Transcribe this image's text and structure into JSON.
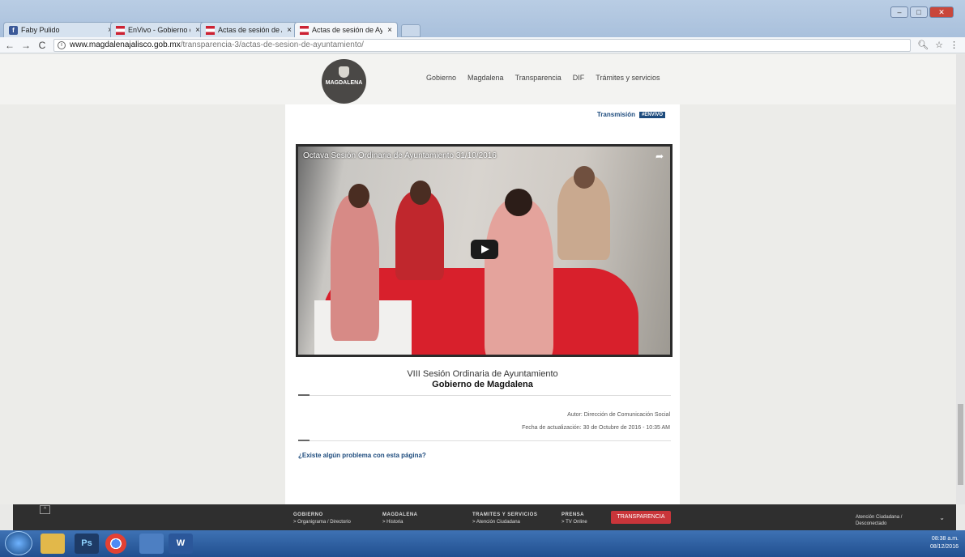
{
  "browser": {
    "tabs": [
      {
        "label": "Faby Pulido",
        "icon": "facebook-icon"
      },
      {
        "label": "EnVivo - Gobierno de M",
        "icon": "gobierno-icon"
      },
      {
        "label": "Actas de sesión de Ayun",
        "icon": "gobierno-icon"
      },
      {
        "label": "Actas de sesión de Ayun",
        "icon": "gobierno-icon",
        "active": true
      }
    ],
    "tab_close": "×",
    "url_host": "www.magdalenajalisco.gob.mx",
    "url_path": "/transparencia-3/actas-de-sesion-de-ayuntamiento/"
  },
  "site": {
    "logo_text": "MAGDALENA",
    "nav": [
      "Gobierno",
      "Magdalena",
      "Transparencia",
      "DIF",
      "Trámites y servicios"
    ],
    "transmision_label": "Transmisión",
    "envivo_badge": "#ENVIVO"
  },
  "video": {
    "title": "Octava Sesión Ordinaria de Ayuntamiento 31/10/2016"
  },
  "article": {
    "caption_line1": "VIII Sesión Ordinaria de Ayuntamiento",
    "caption_line2": "Gobierno de Magdalena",
    "author": "Autor: Dirección de Comunicación Social",
    "updated": "Fecha de actualización: 30 de Octubre de 2016 - 10:35 AM",
    "problem_link": "¿Existe algún problema con esta página?"
  },
  "footer": {
    "columns": [
      {
        "heading": "GOBIERNO",
        "item": "> Organigrama / Directorio"
      },
      {
        "heading": "MAGDALENA",
        "item": "> Historia"
      },
      {
        "heading": "TRAMITES Y SERVICIOS",
        "item": "> Atención Ciudadana"
      },
      {
        "heading": "PRENSA",
        "item": "> TV Online"
      }
    ],
    "transparencia_button": "TRANSPARENCIA",
    "atencion_line1": "Atención Ciudadana /",
    "atencion_line2": "Desconectado"
  },
  "taskbar": {
    "ps_label": "Ps",
    "word_label": "W",
    "clock_time": "08:38 a.m.",
    "clock_date": "08/12/2016"
  },
  "colors": {
    "brand_blue": "#1d4b7d",
    "transparencia_red": "#c9353a",
    "footer_bg": "#2f2f2f"
  }
}
